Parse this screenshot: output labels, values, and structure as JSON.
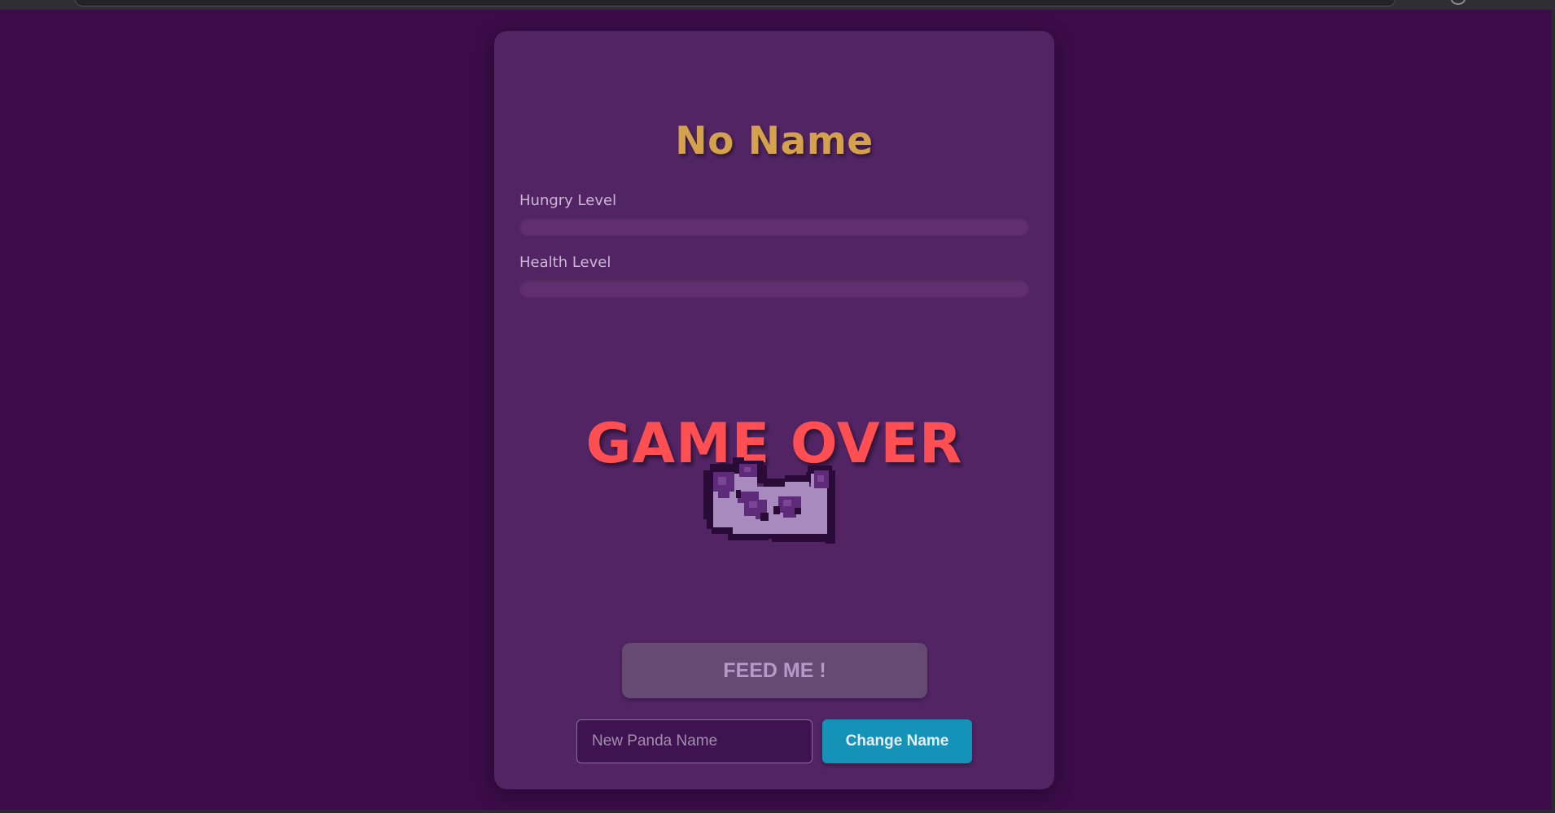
{
  "pet": {
    "name": "No Name",
    "hungry_label": "Hungry Level",
    "hungry_level": 0,
    "health_label": "Health Level",
    "health_level": 0
  },
  "status": {
    "game_over_text": "GAME OVER",
    "sprite_icon": "dead-panda-icon"
  },
  "actions": {
    "feed_label": "FEED ME !",
    "feed_disabled": true,
    "name_input_placeholder": "New Panda Name",
    "name_input_value": "",
    "change_name_label": "Change Name"
  },
  "colors": {
    "page_background": "#3b0c49",
    "card_background": "#522464",
    "name_color": "#d4a24c",
    "game_over_color": "#ff4f52",
    "change_button": "#1592b8"
  }
}
